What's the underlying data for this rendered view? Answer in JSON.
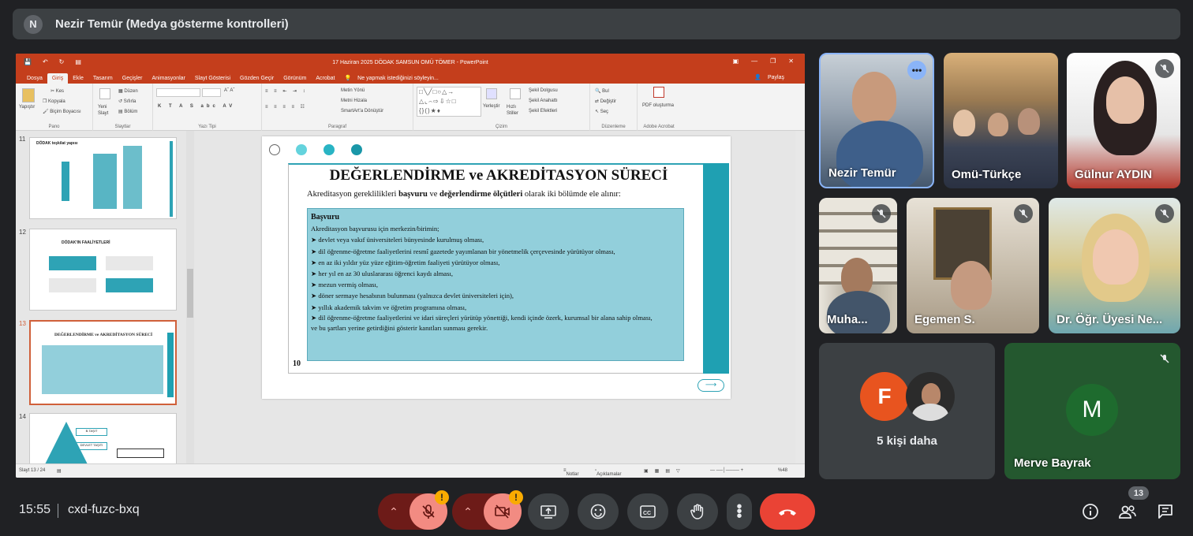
{
  "header": {
    "avatar_letter": "N",
    "title": "Nezir Temür (Medya gösterme kontrolleri)"
  },
  "ppt": {
    "window_title": "17 Haziran 2025  DÖDAK SAMSUN OMÜ TÖMER  -  PowerPoint",
    "tabs": [
      "Dosya",
      "Giriş",
      "Ekle",
      "Tasarım",
      "Geçişler",
      "Animasyonlar",
      "Slayt Gösterisi",
      "Gözden Geçir",
      "Görünüm",
      "Acrobat"
    ],
    "active_tab": "Giriş",
    "tell_me": "Ne yapmak istediğinizi söyleyin...",
    "share": "Paylaş",
    "ribbon": {
      "pano": {
        "label": "Pano",
        "paste": "Yapıştır",
        "cut": "Kes",
        "copy": "Kopyala",
        "format_painter": "Biçim Boyacısı"
      },
      "slaytlar": {
        "label": "Slaytlar",
        "new_slide": "Yeni Slayt",
        "layout": "Düzen",
        "reset": "Sıfırla",
        "section": "Bölüm"
      },
      "yazi_tipi": {
        "label": "Yazı Tipi"
      },
      "paragraf": {
        "label": "Paragraf",
        "text_dir": "Metin Yönü",
        "align_text": "Metni Hizala",
        "smartart": "SmartArt'a Dönüştür"
      },
      "cizim": {
        "label": "Çizim",
        "arrange": "Yerleştir",
        "quick_styles": "Hızlı Stiller",
        "fill": "Şekil Dolgusu",
        "outline": "Şekil Anahattı",
        "effects": "Şekil Efektleri"
      },
      "duzenleme": {
        "label": "Düzenleme",
        "find": "Bul",
        "replace": "Değiştir",
        "select": "Seç"
      },
      "acrobat": {
        "label": "Adobe Acrobat",
        "pdf": "PDF oluşturma"
      }
    },
    "thumbnails": [
      {
        "num": "11",
        "title": "DÖDAK teşkilat yapısı"
      },
      {
        "num": "12",
        "title": "DÖDAK'IN FAALİYETLERİ"
      },
      {
        "num": "13",
        "title": "DEĞERLENDİRME ve AKREDİTASYON SÜRECİ"
      },
      {
        "num": "14",
        "labels": [
          "B.TAŞIT",
          "DEVLET TAŞITI"
        ]
      }
    ],
    "slide": {
      "title": "DEĞERLENDİRME ve AKREDİTASYON SÜRECİ",
      "subtitle_a": "Akreditasyon gereklilikleri ",
      "subtitle_b": "başvuru",
      "subtitle_c": " ve ",
      "subtitle_d": "değerlendirme ölçütleri",
      "subtitle_e": " olarak iki bölümde ele alınır:",
      "box_heading": "Başvuru",
      "intro": "Akreditasyon başvurusu için merkezin/birimin;",
      "bullets": [
        "devlet veya vakıf üniversiteleri bünyesinde kurulmuş olması,",
        "dil öğrenme-öğretme faaliyetlerini resmî gazetede yayımlanan bir yönetmelik çerçevesinde yürütüyor olması,",
        "en az iki yıldır yüz yüze eğitim-öğretim faaliyeti yürütüyor olması,",
        "her yıl en az 30 uluslararası öğrenci kaydı alması,",
        "mezun vermiş olması,",
        "döner sermaye hesabının bulunması (yalnızca devlet üniversiteleri için),",
        "yıllık akademik takvim ve öğretim programına olması,",
        "dil öğrenme-öğretme faaliyetlerini ve idari süreçleri yürütüp yönettiği, kendi içinde özerk, kurumsal bir alana sahip olması,"
      ],
      "closing": "ve bu şartları yerine getirdiğini gösterir kanıtları sunması gerekir.",
      "page_num": "10"
    },
    "status": {
      "slide": "Slayt 13 / 24",
      "notes": "Notlar",
      "comments": "Açıklamalar",
      "zoom": "%48"
    }
  },
  "participants": [
    {
      "name": "Nezir Temür",
      "speaking": true
    },
    {
      "name": "Omü-Türkçe"
    },
    {
      "name": "Gülnur AYDIN",
      "muted": true
    },
    {
      "name": "Muha...",
      "muted": true
    },
    {
      "name": "Egemen S.",
      "muted": true
    },
    {
      "name": "Dr. Öğr. Üyesi Ne...",
      "muted": true
    },
    {
      "name": "5 kişi daha",
      "avatar_letter": "F",
      "avatar_color": "#e8541f"
    },
    {
      "name": "Merve Bayrak",
      "avatar_letter": "M",
      "avatar_color": "#1e6b2e",
      "muted": true
    }
  ],
  "bottom": {
    "time": "15:55",
    "meeting_code": "cxd-fuzc-bxq",
    "people_count": "13",
    "warning": "!"
  }
}
